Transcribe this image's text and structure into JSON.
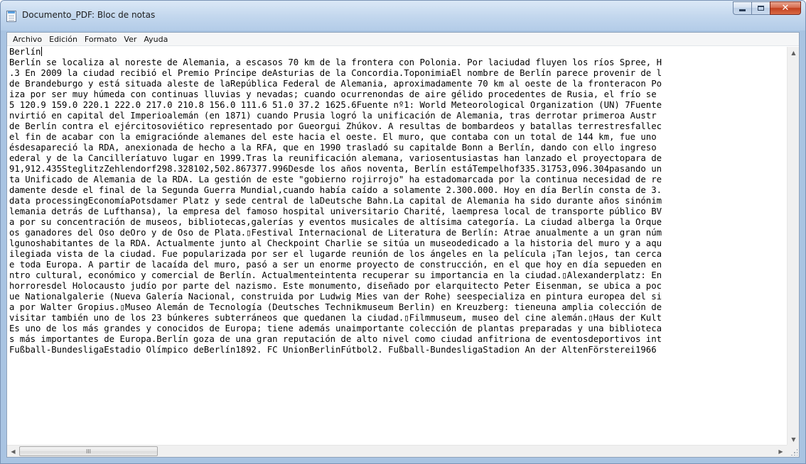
{
  "window": {
    "title": "Documento_PDF: Bloc de notas",
    "caption_buttons": {
      "minimize": "minimize-icon",
      "maximize": "maximize-icon",
      "close": "close-icon"
    }
  },
  "menu": {
    "items": [
      {
        "label": "Archivo"
      },
      {
        "label": "Edición"
      },
      {
        "label": "Formato"
      },
      {
        "label": "Ver"
      },
      {
        "label": "Ayuda"
      }
    ]
  },
  "document": {
    "lines": [
      "Berlín",
      "Berlín se localiza al noreste de Alemania, a escasos 70 km de la frontera con Polonia. Por laciudad fluyen los ríos Spree, H",
      ".3 En 2009 la ciudad recibió el Premio Príncipe deAsturias de la Concordia.ToponimiaEl nombre de Berlín parece provenir de l",
      "de Brandeburgo y está situada aleste de laRepública Federal de Alemania, aproximadamente 70 km al oeste de la fronteracon Po",
      "iza por ser muy húmeda con continuas lluvias y nevadas; cuando ocurrenondas de aire gélido procedentes de Rusia, el frío se",
      "5 120.9 159.0 220.1 222.0 217.0 210.8 156.0 111.6 51.0 37.2 1625.6Fuente nº1: World Meteorological Organization (UN) 7Fuente",
      "nvirtió en capital del Imperioalemán (en 1871) cuando Prusia logró la unificación de Alemania, tras derrotar primeroa Austr",
      "de Berlín contra el ejércitosoviético representado por Gueorgui Zhúkov. A resultas de bombardeos y batallas terrestresfallec",
      "el fin de acabar con la emigraciónde alemanes del este hacia el oeste. El muro, que contaba con un total de 144 km, fue uno",
      "ésdesapareció la RDA, anexionada de hecho a la RFA, que en 1990 trasladó su capitalde Bonn a Berlín, dando con ello ingreso",
      "ederal y de la Cancilleríatuvo lugar en 1999.Tras la reunificación alemana, variosentusiastas han lanzado el proyectopara de",
      "91,912.435SteglitzZehlendorf298.328102,502.867377.996Desde los años noventa, Berlín estáTempelhof335.31753,096.304pasando un",
      "ta Unificado de Alemania de la RDA. La gestión de este \"gobierno rojirrojo\" ha estadomarcada por la continua necesidad de re",
      "damente desde el final de la Segunda Guerra Mundial,cuando había caído a solamente 2.300.000. Hoy en día Berlín consta de 3.",
      "data processingEconomíaPotsdamer Platz y sede central de laDeutsche Bahn.La capital de Alemania ha sido durante años sinónim",
      "lemania detrás de Lufthansa), la empresa del famoso hospital universitario Charité, laempresa local de transporte público BV",
      "a por su concentración de museos, bibliotecas,galerías y eventos musicales de altísima categoría. La ciudad alberga la Orque",
      "os ganadores del Oso deOro y de Oso de Plata.▯Festival Internacional de Literatura de Berlín: Atrae anualmente a un gran núm",
      "lgunoshabitantes de la RDA. Actualmente junto al Checkpoint Charlie se sitúa un museodedicado a la historia del muro y a aqu",
      "ilegiada vista de la ciudad. Fue popularizada por ser el lugarde reunión de los ángeles en la película ¡Tan lejos, tan cerca",
      "e toda Europa. A partir de lacaída del muro, pasó a ser un enorme proyecto de construcción, en el que hoy en día sepueden en",
      "ntro cultural, económico y comercial de Berlín. Actualmenteintenta recuperar su importancia en la ciudad.▯Alexanderplatz: En",
      "horroresdel Holocausto judío por parte del nazismo. Este monumento, diseñado por elarquitecto Peter Eisenman, se ubica a poc",
      "ue Nationalgalerie (Nueva Galería Nacional, construida por Ludwig Mies van der Rohe) seespecializa en pintura europea del si",
      "a por Walter Gropius.▯Museo Alemán de Tecnología (Deutsches Technikmuseum Berlin) en Kreuzberg: tieneuna amplia colección de",
      "visitar también uno de los 23 búnkeres subterráneos que quedanen la ciudad.▯Filmmuseum, museo del cine alemán.▯Haus der Kult",
      "Es uno de los más grandes y conocidos de Europa; tiene además unaimportante colección de plantas preparadas y una biblioteca",
      "s más importantes de Europa.Berlín goza de una gran reputación de alto nivel como ciudad anfitriona de eventosdeportivos int",
      "Fußball-BundesligaEstadio Olímpico deBerlín1892. FC UnionBerlinFútbol2. Fußball-BundesligaStadion An der AltenFörsterei1966"
    ]
  },
  "scrollbars": {
    "up_arrow": "▲",
    "down_arrow": "▼",
    "left_arrow": "◀",
    "right_arrow": "▶",
    "thumb_grip": "III"
  }
}
